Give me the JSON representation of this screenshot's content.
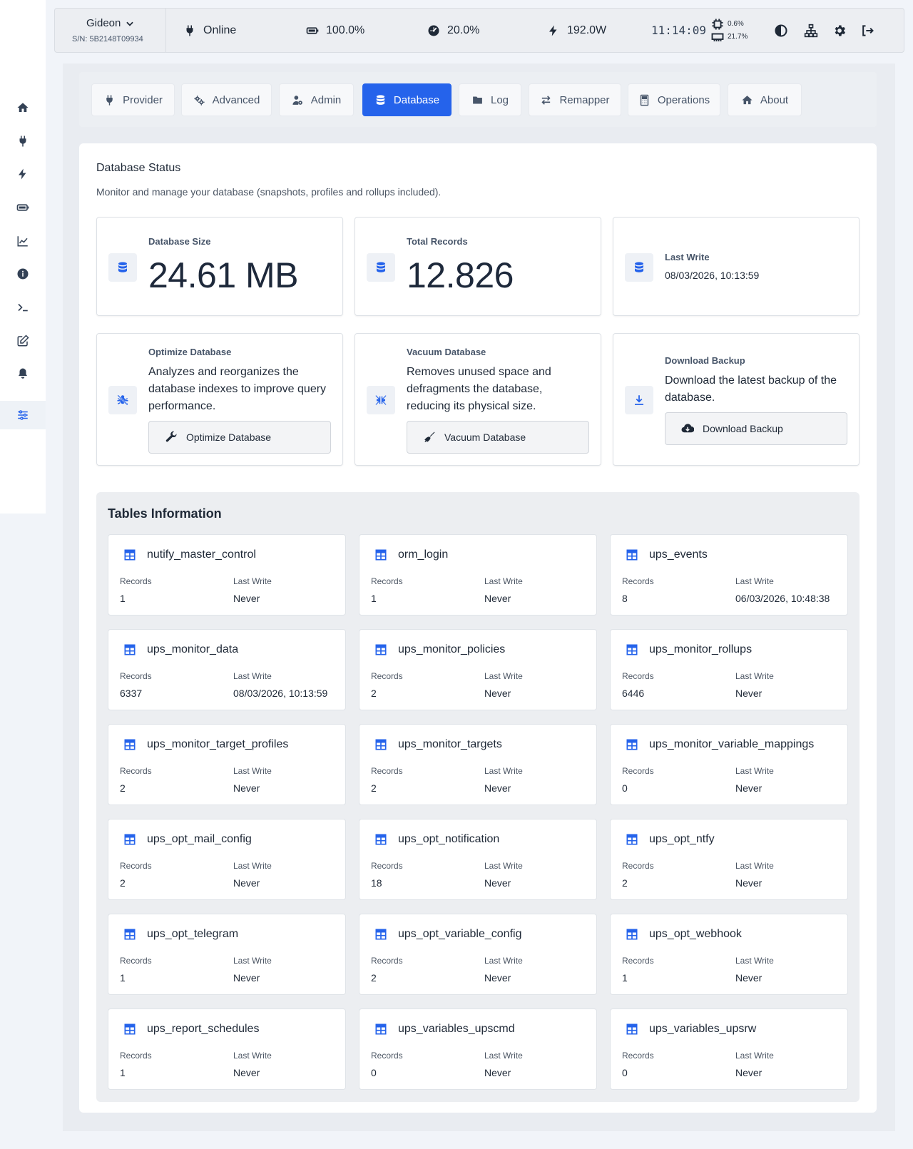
{
  "header": {
    "device_name": "Gideon",
    "serial": "S/N: 5B2148T09934",
    "status": "Online",
    "battery": "100.0%",
    "load": "20.0%",
    "power": "192.0W",
    "clock": "11:14:09",
    "cpu": "0.6%",
    "mem": "21.7%"
  },
  "tabs": [
    {
      "label": "Provider",
      "icon": "plug-icon"
    },
    {
      "label": "Advanced",
      "icon": "gears-icon"
    },
    {
      "label": "Admin",
      "icon": "user-gear-icon"
    },
    {
      "label": "Database",
      "icon": "database-icon"
    },
    {
      "label": "Log",
      "icon": "folder-icon"
    },
    {
      "label": "Remapper",
      "icon": "arrows-icon"
    },
    {
      "label": "Operations",
      "icon": "calculator-icon"
    },
    {
      "label": "About",
      "icon": "house-icon"
    }
  ],
  "status": {
    "title": "Database Status",
    "subtitle": "Monitor and manage your database (snapshots, profiles and rollups included).",
    "size_label": "Database Size",
    "size_value": "24.61 MB",
    "records_label": "Total Records",
    "records_value": "12.826",
    "last_write_label": "Last Write",
    "last_write_value": "08/03/2026, 10:13:59"
  },
  "actions": {
    "optimize": {
      "title": "Optimize Database",
      "desc": "Analyzes and reorganizes the database indexes to improve query performance.",
      "button": "Optimize Database"
    },
    "vacuum": {
      "title": "Vacuum Database",
      "desc": "Removes unused space and defragments the database, reducing its physical size.",
      "button": "Vacuum Database"
    },
    "backup": {
      "title": "Download Backup",
      "desc": "Download the latest backup of the database.",
      "button": "Download Backup"
    }
  },
  "tables": {
    "title": "Tables Information",
    "records_label": "Records",
    "last_write_label": "Last Write",
    "items": [
      {
        "name": "nutify_master_control",
        "records": "1",
        "last_write": "Never"
      },
      {
        "name": "orm_login",
        "records": "1",
        "last_write": "Never"
      },
      {
        "name": "ups_events",
        "records": "8",
        "last_write": "06/03/2026, 10:48:38"
      },
      {
        "name": "ups_monitor_data",
        "records": "6337",
        "last_write": "08/03/2026, 10:13:59"
      },
      {
        "name": "ups_monitor_policies",
        "records": "2",
        "last_write": "Never"
      },
      {
        "name": "ups_monitor_rollups",
        "records": "6446",
        "last_write": "Never"
      },
      {
        "name": "ups_monitor_target_profiles",
        "records": "2",
        "last_write": "Never"
      },
      {
        "name": "ups_monitor_targets",
        "records": "2",
        "last_write": "Never"
      },
      {
        "name": "ups_monitor_variable_mappings",
        "records": "0",
        "last_write": "Never"
      },
      {
        "name": "ups_opt_mail_config",
        "records": "2",
        "last_write": "Never"
      },
      {
        "name": "ups_opt_notification",
        "records": "18",
        "last_write": "Never"
      },
      {
        "name": "ups_opt_ntfy",
        "records": "2",
        "last_write": "Never"
      },
      {
        "name": "ups_opt_telegram",
        "records": "1",
        "last_write": "Never"
      },
      {
        "name": "ups_opt_variable_config",
        "records": "2",
        "last_write": "Never"
      },
      {
        "name": "ups_opt_webhook",
        "records": "1",
        "last_write": "Never"
      },
      {
        "name": "ups_report_schedules",
        "records": "1",
        "last_write": "Never"
      },
      {
        "name": "ups_variables_upscmd",
        "records": "0",
        "last_write": "Never"
      },
      {
        "name": "ups_variables_upsrw",
        "records": "0",
        "last_write": "Never"
      }
    ]
  },
  "colors": {
    "accent": "#2563eb"
  }
}
